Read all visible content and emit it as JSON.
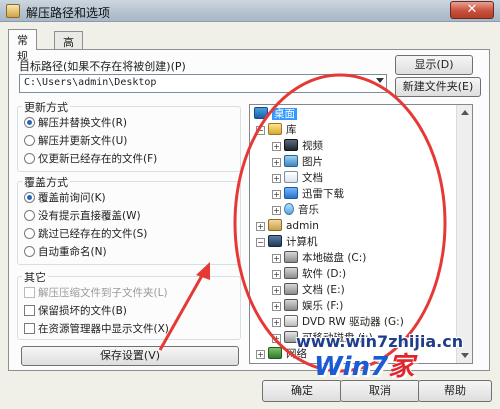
{
  "window": {
    "title": "解压路径和选项",
    "close_glyph": "✕"
  },
  "tabs": [
    {
      "label": "常规",
      "active": true
    },
    {
      "label": "高级",
      "active": false
    }
  ],
  "target": {
    "label": "目标路径(如果不存在将被创建)(P)",
    "value": "C:\\Users\\admin\\Desktop",
    "show_button": "显示(D)",
    "new_folder_button": "新建文件夹(E)"
  },
  "update_mode": {
    "title": "更新方式",
    "options": [
      {
        "label": "解压并替换文件(R)",
        "selected": true
      },
      {
        "label": "解压并更新文件(U)",
        "selected": false
      },
      {
        "label": "仅更新已经存在的文件(F)",
        "selected": false
      }
    ]
  },
  "overwrite_mode": {
    "title": "覆盖方式",
    "options": [
      {
        "label": "覆盖前询问(K)",
        "selected": true
      },
      {
        "label": "没有提示直接覆盖(W)",
        "selected": false
      },
      {
        "label": "跳过已经存在的文件(S)",
        "selected": false
      },
      {
        "label": "自动重命名(N)",
        "selected": false
      }
    ]
  },
  "other": {
    "title": "其它",
    "options": [
      {
        "label": "解压压缩文件到子文件夹(L)",
        "checked": false,
        "disabled": true
      },
      {
        "label": "保留损坏的文件(B)",
        "checked": false,
        "disabled": false
      },
      {
        "label": "在资源管理器中显示文件(X)",
        "checked": false,
        "disabled": false
      }
    ]
  },
  "save_settings_button": "保存设置(V)",
  "tree": {
    "nodes": [
      {
        "label": "桌面",
        "icon": "desktop-icon",
        "selected": true,
        "expander": ""
      },
      {
        "label": "库",
        "icon": "library-icon",
        "expander": "−"
      },
      {
        "label": "视频",
        "icon": "video-icon",
        "expander": "+"
      },
      {
        "label": "图片",
        "icon": "picture-icon",
        "expander": "+"
      },
      {
        "label": "文档",
        "icon": "document-icon",
        "expander": "+"
      },
      {
        "label": "迅雷下载",
        "icon": "download-icon",
        "expander": "+"
      },
      {
        "label": "音乐",
        "icon": "music-icon",
        "expander": "+"
      },
      {
        "label": "admin",
        "icon": "user-folder-icon",
        "expander": "+"
      },
      {
        "label": "计算机",
        "icon": "computer-icon",
        "expander": "−"
      },
      {
        "label": "本地磁盘 (C:)",
        "icon": "disk-icon",
        "expander": "+"
      },
      {
        "label": "软件 (D:)",
        "icon": "disk-icon",
        "expander": "+"
      },
      {
        "label": "文档 (E:)",
        "icon": "disk-icon",
        "expander": "+"
      },
      {
        "label": "娱乐 (F:)",
        "icon": "disk-icon",
        "expander": "+"
      },
      {
        "label": "DVD RW 驱动器 (G:)",
        "icon": "dvd-icon",
        "expander": "+"
      },
      {
        "label": "可移动磁盘 (I:)",
        "icon": "usb-icon",
        "expander": "+"
      },
      {
        "label": "网络",
        "icon": "network-icon",
        "expander": "+"
      }
    ]
  },
  "buttons": {
    "ok": "确定",
    "cancel": "取消",
    "help": "帮助"
  },
  "watermark": {
    "url": "www.win7zhijia.cn",
    "logo_text": "Win7",
    "logo_suffix": "家"
  },
  "annotation": {
    "color": "#e53935"
  }
}
